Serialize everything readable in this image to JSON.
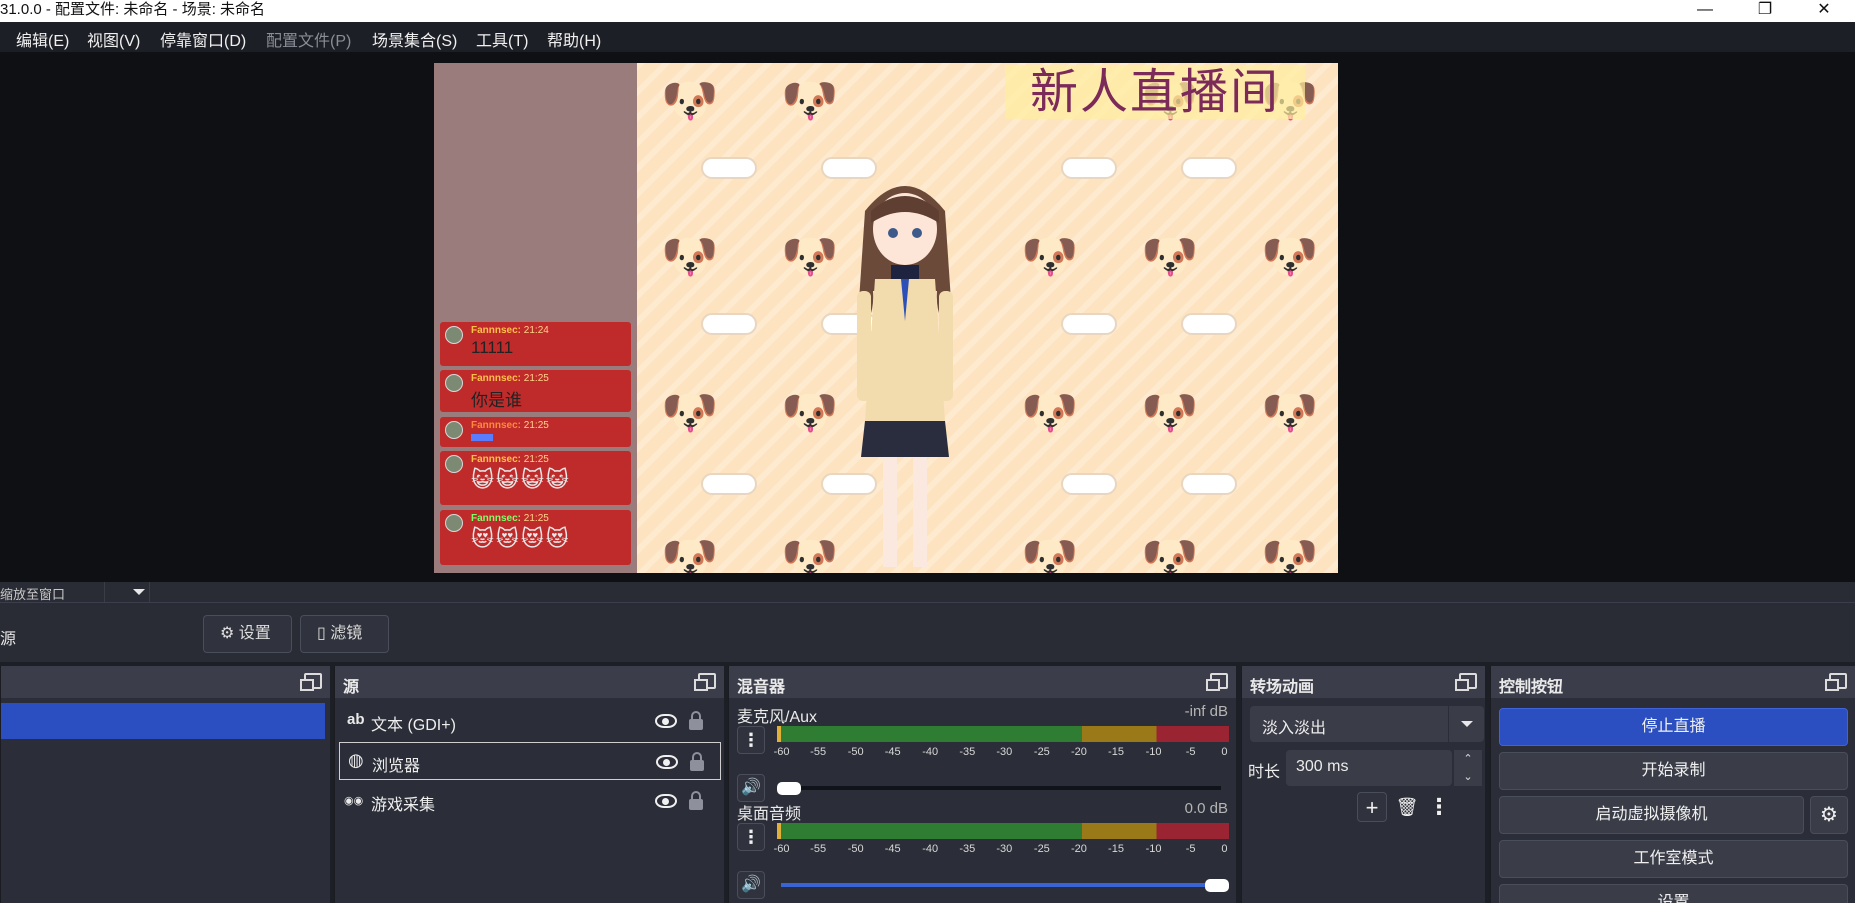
{
  "window": {
    "title": "31.0.0 - 配置文件: 未命名 - 场景: 未命名",
    "minimize": "—",
    "restore": "❐",
    "close": "✕"
  },
  "menu": [
    {
      "label": "编辑(E)",
      "enabled": true
    },
    {
      "label": "视图(V)",
      "enabled": true
    },
    {
      "label": "停靠窗口(D)",
      "enabled": true
    },
    {
      "label": "配置文件(P)",
      "enabled": false
    },
    {
      "label": "场景集合(S)",
      "enabled": true
    },
    {
      "label": "工具(T)",
      "enabled": true
    },
    {
      "label": "帮助(H)",
      "enabled": true
    }
  ],
  "preview": {
    "stream_title": "新人直播间",
    "chat": [
      {
        "user": "Fannnsec:",
        "time": "21:24",
        "text": "11111"
      },
      {
        "user": "Fannnsec:",
        "time": "21:25",
        "text": "你是谁"
      },
      {
        "user": "Fannnsec:",
        "time": "21:25",
        "text": ""
      },
      {
        "user": "Fannnsec:",
        "time": "21:25",
        "text": "😺😺😺😺"
      },
      {
        "user": "Fannnsec:",
        "time": "21:25",
        "text": "😻😻😻😻"
      }
    ]
  },
  "dock_bar": {
    "label": "缩放至窗口"
  },
  "toolbar": {
    "source_label": "源",
    "settings_label": "⚙ 设置",
    "filters_label": "▯ 滤镜"
  },
  "panels": {
    "sources": {
      "title": "源",
      "items": [
        {
          "icon": "ab",
          "name": "文本 (GDI+)"
        },
        {
          "icon": "◍",
          "name": "浏览器"
        },
        {
          "icon": "◉◉",
          "name": "游戏采集"
        }
      ]
    },
    "mixer": {
      "title": "混音器",
      "channels": [
        {
          "name": "麦克风/Aux",
          "db": "-inf dB",
          "volume": 0.0
        },
        {
          "name": "桌面音频",
          "db": "0.0 dB",
          "volume": 1.0
        }
      ],
      "scale": [
        "-60",
        "-55",
        "-50",
        "-45",
        "-40",
        "-35",
        "-30",
        "-25",
        "-20",
        "-15",
        "-10",
        "-5",
        "0"
      ]
    },
    "transitions": {
      "title": "转场动画",
      "selected": "淡入淡出",
      "duration_label": "时长",
      "duration_value": "300 ms"
    },
    "controls": {
      "title": "控制按钮",
      "stop_stream": "停止直播",
      "start_recording": "开始录制",
      "virtual_camera": "启动虚拟摄像机",
      "studio_mode": "工作室模式",
      "settings": "设置"
    }
  },
  "colors": {
    "accent": "#2b4fc1",
    "panel_bg": "#2b2e38",
    "chat_bg": "#bf2b2b"
  }
}
